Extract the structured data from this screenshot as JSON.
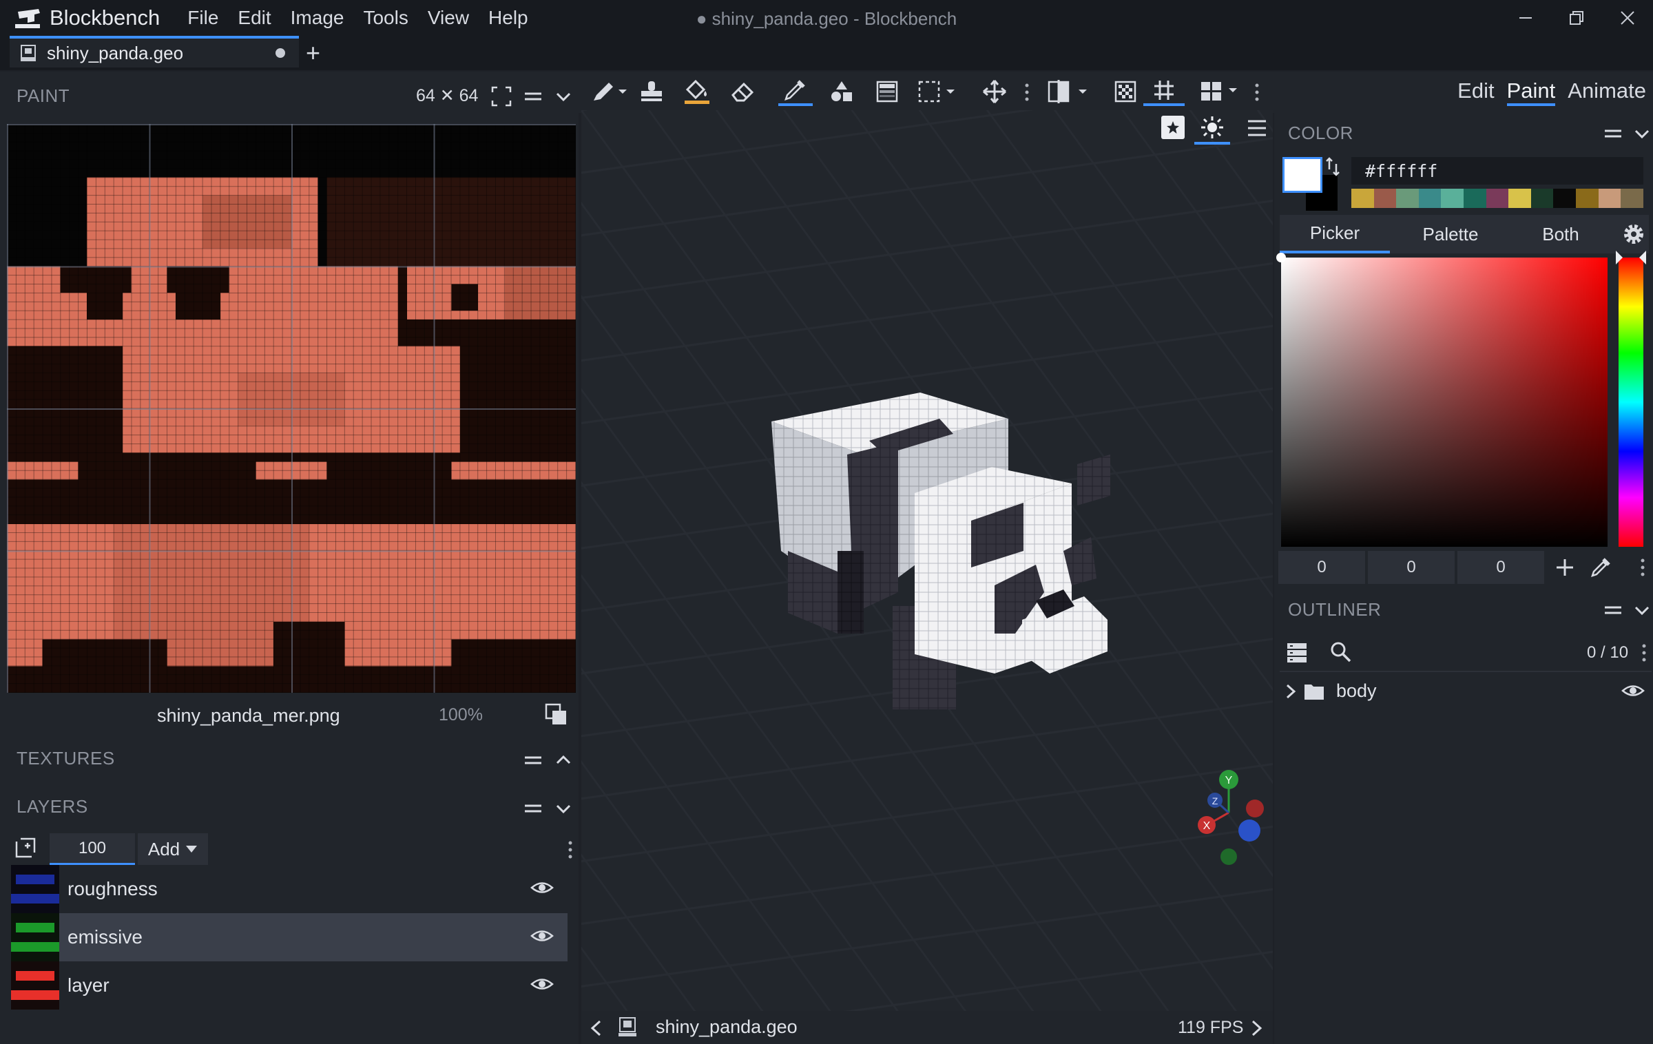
{
  "app": {
    "name": "Blockbench",
    "window_title": "● shiny_panda.geo - Blockbench",
    "menu": [
      "File",
      "Edit",
      "Image",
      "Tools",
      "View",
      "Help"
    ]
  },
  "tab": {
    "label": "shiny_panda.geo",
    "add_label": "+"
  },
  "paint_panel": {
    "title": "PAINT",
    "resolution": "64 ✕ 64",
    "texture_name": "shiny_panda_mer.png",
    "zoom": "100%"
  },
  "textures_panel": {
    "title": "TEXTURES"
  },
  "layers_panel": {
    "title": "LAYERS",
    "opacity": "100",
    "add_label": "Add",
    "layers": [
      {
        "name": "roughness",
        "color": "#1a2b9a",
        "selected": false
      },
      {
        "name": "emissive",
        "color": "#1b9a2a",
        "selected": true
      },
      {
        "name": "layer",
        "color": "#e8302a",
        "selected": false
      }
    ]
  },
  "toolbar": {
    "tools": [
      "brush-icon",
      "stamp-icon",
      "fill-icon",
      "eraser-icon",
      "eyedropper-icon",
      "shapes-icon",
      "gradient-icon",
      "selection-icon",
      "move-icon",
      "mirror-icon",
      "checker-icon",
      "grid-icon",
      "layout-icon"
    ],
    "active_tools": [
      "eyedropper-icon",
      "grid-icon"
    ]
  },
  "modes": [
    "Edit",
    "Paint",
    "Animate"
  ],
  "active_mode": "Paint",
  "color_panel": {
    "title": "COLOR",
    "hex": "#ffffff",
    "tabs": [
      "Picker",
      "Palette",
      "Both"
    ],
    "active_tab": "Picker",
    "rgb": [
      "0",
      "0",
      "0"
    ],
    "swatches": [
      "#c9a63a",
      "#9a5a4a",
      "#6a9a7a",
      "#3a8a8a",
      "#5ab09a",
      "#1a6a5a",
      "#7a3a5a",
      "#d8c24a",
      "#1a3a2a",
      "#0a0a0a",
      "#8a6a1a",
      "#c89a7a",
      "#7a6a4a"
    ]
  },
  "outliner": {
    "title": "OUTLINER",
    "count": "0 / 10",
    "items": [
      {
        "name": "body"
      }
    ]
  },
  "viewport": {
    "footer_file": "shiny_panda.geo",
    "fps": "119 FPS"
  }
}
